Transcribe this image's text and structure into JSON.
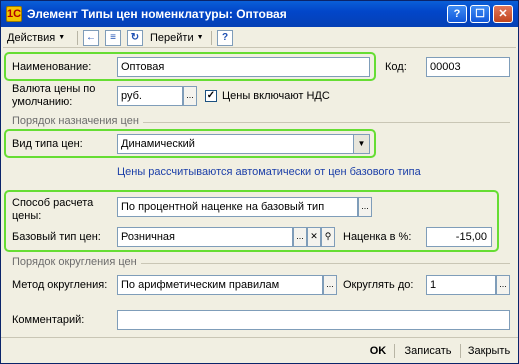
{
  "window": {
    "title": "Элемент Типы цен номенклатуры: Оптовая",
    "app_icon_glyph": "1С",
    "minimize_glyph": "?",
    "maximize_glyph": "☐",
    "close_glyph": "✕"
  },
  "toolbar": {
    "actions_label": "Действия",
    "navigate_label": "Перейти",
    "help_glyph": "?",
    "icon1_glyph": "←",
    "icon2_glyph": "≡",
    "icon3_glyph": "↻"
  },
  "form": {
    "name_label": "Наименование:",
    "name_value": "Оптовая",
    "code_label": "Код:",
    "code_value": "00003",
    "currency_label_line1": "Валюта цены по",
    "currency_label_line2": "умолчанию:",
    "currency_value": "руб.",
    "vat_checked": true,
    "vat_label": "Цены включают НДС",
    "section_purpose": "Порядок назначения цен",
    "price_kind_label": "Вид типа цен:",
    "price_kind_value": "Динамический",
    "auto_info": "Цены рассчитываются автоматически от цен базового типа",
    "calc_method_label_line1": "Способ расчета",
    "calc_method_label_line2": "цены:",
    "calc_method_value": "По процентной наценке на базовый тип",
    "base_type_label": "Базовый тип цен:",
    "base_type_value": "Розничная",
    "markup_label": "Наценка в %:",
    "markup_value": "-15,00",
    "section_rounding": "Порядок округления цен",
    "rounding_method_label": "Метод округления:",
    "rounding_method_value": "По арифметическим правилам",
    "round_to_label": "Округлять до:",
    "round_to_value": "1",
    "comment_label": "Комментарий:",
    "comment_value": ""
  },
  "footer": {
    "ok_label": "OK",
    "save_label": "Записать",
    "close_label": "Закрыть"
  },
  "colors": {
    "highlight": "#66dd33",
    "title_bar": "#0246c9",
    "info_text": "#1c3fa8"
  }
}
